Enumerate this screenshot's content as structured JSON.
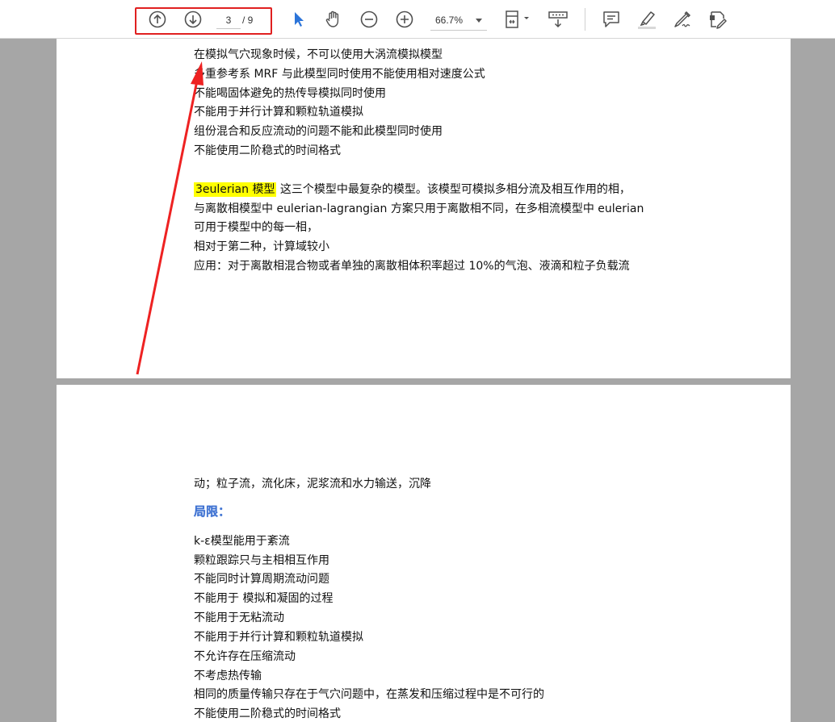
{
  "toolbar": {
    "page_current": "3",
    "page_total": "/ 9",
    "zoom": "66.7%",
    "icons": [
      "up-arrow-icon",
      "down-arrow-icon",
      "select-cursor-icon",
      "hand-icon",
      "zoom-out-icon",
      "zoom-in-icon",
      "fit-page-icon",
      "scroll-mode-icon",
      "comment-icon",
      "highlight-pen-icon",
      "sign-icon",
      "edit-pdf-icon"
    ],
    "accent_color": "#2b74d9",
    "annotation_color": "#e02020"
  },
  "page1": {
    "lines": [
      "在模拟气穴现象时候，不可以使用大涡流模拟模型",
      "多重参考系 MRF 与此模型同时使用不能使用相对速度公式",
      "不能喝固体避免的热传导模拟同时使用",
      "不能用于并行计算和颗粒轨道模拟",
      "组份混合和反应流动的问题不能和此模型同时使用",
      "不能使用二阶稳式的时间格式"
    ],
    "highlight_label": "3eulerian  模型",
    "para_line1": " 这三个模型中最复杂的模型。该模型可模拟多相分流及相互作用的相，",
    "para_lines": [
      "与离散相模型中  eulerian-lagrangian  方案只用于离散相不同，在多相流模型中  eulerian",
      "可用于模型中的每一相，",
      "相对于第二种，计算域较小",
      "应用：对于离散相混合物或者单独的离散相体积率超过 10%的气泡、液滴和粒子负载流"
    ]
  },
  "page2": {
    "first_line": "动；粒子流，流化床，泥浆流和水力输送，沉降",
    "heading": "局限：",
    "lines": [
      "k-ε模型能用于紊流",
      "颗粒跟踪只与主相相互作用",
      "不能同时计算周期流动问题",
      "不能用于  模拟和凝固的过程",
      "不能用于无粘流动",
      "不能用于并行计算和颗粒轨道模拟",
      "不允许存在压缩流动",
      "不考虑热传输",
      "相同的质量传输只存在于气穴问题中，在蒸发和压缩过程中是不可行的",
      "不能使用二阶稳式的时间格式"
    ]
  }
}
